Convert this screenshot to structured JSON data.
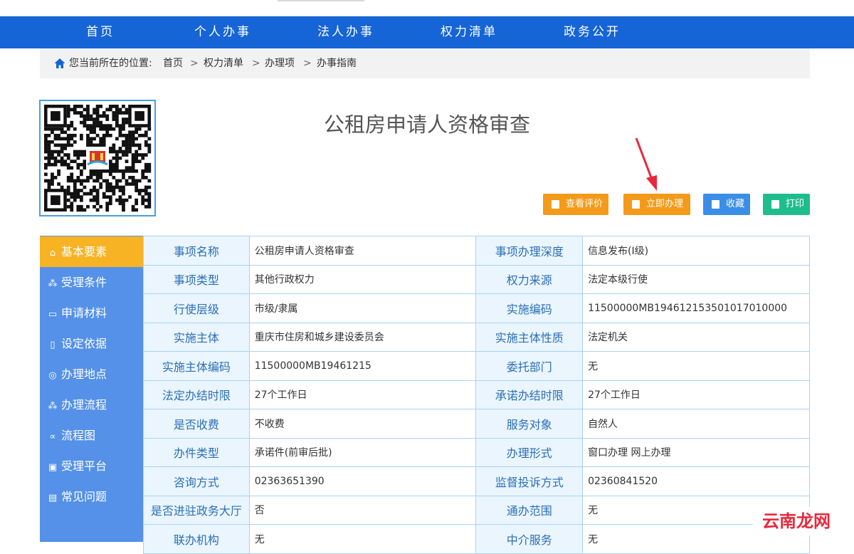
{
  "nav": [
    "首页",
    "个人办事",
    "法人办事",
    "权力清单",
    "政务公开"
  ],
  "breadcrumb": {
    "prefix": "您当前所在的位置:",
    "items": [
      "首页",
      "权力清单",
      "办理项",
      "办事指南"
    ],
    "separator": ">"
  },
  "title": "公租房申请人资格审查",
  "buttons": [
    {
      "label": "查看评价",
      "color": "#f49a1a"
    },
    {
      "label": "立即办理",
      "color": "#f49a1a"
    },
    {
      "label": "收藏",
      "color": "#3a8ee6"
    },
    {
      "label": "打印",
      "color": "#1fbd8e"
    }
  ],
  "sidebar": [
    {
      "label": "基本要素",
      "icon": "home-icon",
      "active": true
    },
    {
      "label": "受理条件",
      "icon": "network-icon"
    },
    {
      "label": "申请材料",
      "icon": "folder-icon"
    },
    {
      "label": "设定依据",
      "icon": "document-icon"
    },
    {
      "label": "办理地点",
      "icon": "location-icon"
    },
    {
      "label": "办理流程",
      "icon": "flow-icon"
    },
    {
      "label": "流程图",
      "icon": "share-icon"
    },
    {
      "label": "受理平台",
      "icon": "monitor-icon"
    },
    {
      "label": "常见问题",
      "icon": "question-icon"
    }
  ],
  "table": [
    [
      "事项名称",
      "公租房申请人资格审查",
      "事项办理深度",
      "信息发布(Ⅰ级)"
    ],
    [
      "事项类型",
      "其他行政权力",
      "权力来源",
      "法定本级行使"
    ],
    [
      "行使层级",
      "市级/隶属",
      "实施编码",
      "11500000MB19461215350101701000​0"
    ],
    [
      "实施主体",
      "重庆市住房和城乡建设委员会",
      "实施主体性质",
      "法定机关"
    ],
    [
      "实施主体编码",
      "11500000MB19461215",
      "委托部门",
      "无"
    ],
    [
      "法定办结时限",
      "27个工作日",
      "承诺办结时限",
      "27个工作日"
    ],
    [
      "是否收费",
      "不收费",
      "服务对象",
      "自然人"
    ],
    [
      "办件类型",
      "承诺件(前审后批)",
      "办理形式",
      "窗口办理  网上办理"
    ],
    [
      "咨询方式",
      "02363651390",
      "监督投诉方式",
      "02360841520"
    ],
    [
      "是否进驻政务大厅",
      "否",
      "通办范围",
      "无"
    ],
    [
      "联办机构",
      "无",
      "中介服务",
      "无"
    ]
  ],
  "watermark": "云南龙网",
  "colors": {
    "nav": "#1565d6",
    "sidebar": "#5591e8",
    "sidebar_active": "#f7b324",
    "table_border": "#a9d3f5",
    "key_bg": "#eaf5fd",
    "key_text": "#2b6fb6",
    "arrow": "#e8283c"
  }
}
